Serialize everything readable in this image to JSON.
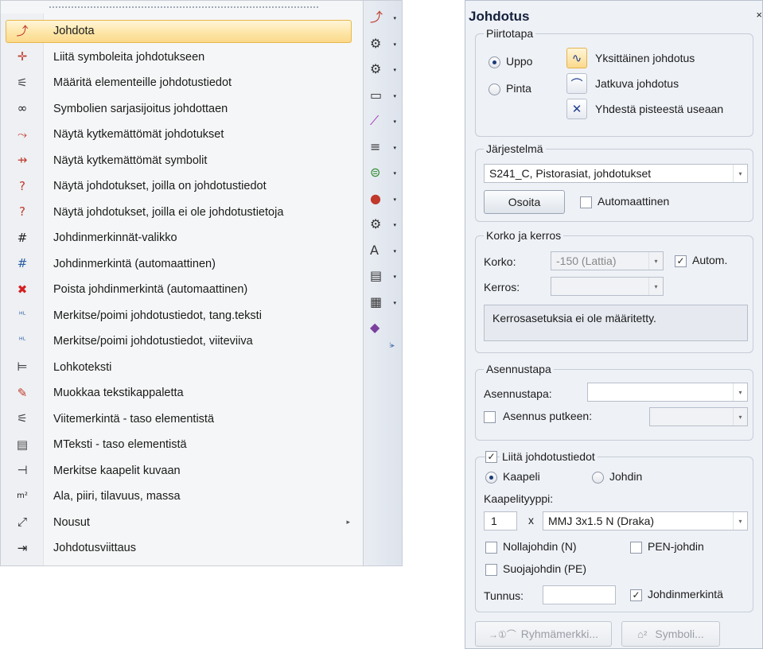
{
  "menu": {
    "items": [
      {
        "label": "Johdota",
        "icon": "wire-route-icon",
        "glyph": "⤴",
        "color": "#c0392b"
      },
      {
        "label": "Liitä symboleita johdotukseen",
        "icon": "attach-symbol-icon",
        "glyph": "✛",
        "color": "#c0392b"
      },
      {
        "label": "Määritä elementeille johdotustiedot",
        "icon": "element-wiring-data-icon",
        "glyph": "⚟",
        "color": "#444"
      },
      {
        "label": "Symbolien sarjasijoitus johdottaen",
        "icon": "series-placement-icon",
        "glyph": "∞",
        "color": "#222"
      },
      {
        "label": "Näytä kytkemättömät johdotukset",
        "icon": "unconnected-wiring-icon",
        "glyph": "⤳",
        "color": "#c0392b"
      },
      {
        "label": "Näytä kytkemättömät symbolit",
        "icon": "unconnected-symbols-icon",
        "glyph": "⇸",
        "color": "#c0392b"
      },
      {
        "label": "Näytä johdotukset, joilla on johdotustiedot",
        "icon": "wiring-with-data-icon",
        "glyph": "?",
        "color": "#c0392b"
      },
      {
        "label": "Näytä johdotukset, joilla ei ole johdotustietoja",
        "icon": "wiring-without-data-icon",
        "glyph": "?",
        "color": "#c0392b"
      },
      {
        "label": "Johdinmerkinnät-valikko",
        "icon": "conductor-marking-menu-icon",
        "glyph": "#",
        "color": "#222"
      },
      {
        "label": "Johdinmerkintä (automaattinen)",
        "icon": "conductor-marking-auto-icon",
        "glyph": "#",
        "color": "#2b5fa6"
      },
      {
        "label": "Poista johdinmerkintä (automaattinen)",
        "icon": "remove-conductor-marking-icon",
        "glyph": "✖",
        "color": "#d42020"
      },
      {
        "label": "Merkitse/poimi johdotustiedot, tang.teksti",
        "icon": "tangent-text-icon",
        "glyph": "ᴴᴸ",
        "color": "#2b5fa6"
      },
      {
        "label": "Merkitse/poimi johdotustiedot, viiteviiva",
        "icon": "leader-line-icon",
        "glyph": "ᴴᴸ",
        "color": "#2b5fa6"
      },
      {
        "label": "Lohkoteksti",
        "icon": "block-text-icon",
        "glyph": "⊨",
        "color": "#222"
      },
      {
        "label": "Muokkaa tekstikappaletta",
        "icon": "edit-text-paragraph-icon",
        "glyph": "✎",
        "color": "#c0392b"
      },
      {
        "label": "Viitemerkintä - taso elementistä",
        "icon": "reference-mark-icon",
        "glyph": "⚟",
        "color": "#444"
      },
      {
        "label": "MTeksti - taso elementistä",
        "icon": "mtext-icon",
        "glyph": "▤",
        "color": "#444"
      },
      {
        "label": "Merkitse kaapelit kuvaan",
        "icon": "mark-cables-icon",
        "glyph": "⊣",
        "color": "#222"
      },
      {
        "label": "Ala, piiri, tilavuus, massa",
        "icon": "area-perimeter-icon",
        "glyph": "m²",
        "color": "#222"
      },
      {
        "label": "Nousut",
        "icon": "risers-icon",
        "glyph": "⤢",
        "color": "#222",
        "submenu": "▸"
      },
      {
        "label": "Johdotusviittaus",
        "icon": "wiring-reference-icon",
        "glyph": "⇥",
        "color": "#222"
      }
    ]
  },
  "toolbar": {
    "buttons": [
      {
        "icon": "wire-route-icon",
        "glyph": "⤴",
        "color": "#c0392b"
      },
      {
        "icon": "gear-settings-icon",
        "glyph": "⚙",
        "color": "#333"
      },
      {
        "icon": "gear-tool-icon",
        "glyph": "⚙",
        "color": "#333"
      },
      {
        "icon": "panel-icon",
        "glyph": "▭",
        "color": "#333"
      },
      {
        "icon": "line-tool-icon",
        "glyph": "⟋",
        "color": "#9c27b0"
      },
      {
        "icon": "stripes-icon",
        "glyph": "≡",
        "color": "#333"
      },
      {
        "icon": "earth-icon",
        "glyph": "⊜",
        "color": "#2e8b2e"
      },
      {
        "icon": "component-icon",
        "glyph": "●",
        "color": "#c0392b"
      },
      {
        "icon": "gear-3d-icon",
        "glyph": "⚙",
        "color": "#333"
      },
      {
        "icon": "text-tool-icon",
        "glyph": "A",
        "color": "#333"
      },
      {
        "icon": "clipboard-icon",
        "glyph": "▤",
        "color": "#333"
      },
      {
        "icon": "document-stack-icon",
        "glyph": "▦",
        "color": "#333"
      },
      {
        "icon": "book-icon",
        "glyph": "◆",
        "color": "#7b3f9e"
      }
    ],
    "dropdown_glyph": "▾",
    "expand_glyph": "⁞▸"
  },
  "panel": {
    "title": "Johdotus",
    "close": "×",
    "drawing_mode": {
      "legend": "Piirtotapa",
      "uppo": "Uppo",
      "pinta": "Pinta",
      "single": "Yksittäinen johdotus",
      "continuous": "Jatkuva johdotus",
      "from_one_point": "Yhdestä pisteestä useaan",
      "single_icon": "∿",
      "continuous_icon": "⌒",
      "from_point_icon": "✕"
    },
    "system": {
      "legend": "Järjestelmä",
      "value": "S241_C, Pistorasiat, johdotukset",
      "point_button": "Osoita",
      "automatic": "Automaattinen"
    },
    "level": {
      "legend": "Korko ja kerros",
      "korko_label": "Korko:",
      "korko_value": "-150 (Lattia)",
      "autom": "Autom.",
      "kerros_label": "Kerros:",
      "kerros_value": "",
      "info": "Kerrosasetuksia ei ole määritetty."
    },
    "install": {
      "legend": "Asennustapa",
      "label": "Asennustapa:",
      "value": "",
      "in_pipe": "Asennus putkeen:",
      "pipe_value": ""
    },
    "wiring": {
      "legend": "Liitä johdotustiedot",
      "cable": "Kaapeli",
      "conductor": "Johdin",
      "cable_type_label": "Kaapelityyppi:",
      "count": "1",
      "times": "x",
      "cable_type": "MMJ 3x1.5 N (Draka)",
      "neutral": "Nollajohdin (N)",
      "pen": "PEN-johdin",
      "protective": "Suojajohdin (PE)",
      "tunnus_label": "Tunnus:",
      "tunnus_value": "",
      "marking": "Johdinmerkintä"
    },
    "buttons": {
      "group_mark": "Ryhmämerkki...",
      "group_mark_icon": "→①⌒",
      "symbol": "Symboli...",
      "symbol_icon": "⌂²"
    },
    "check_glyph": "✓",
    "dd_glyph": "▾"
  }
}
